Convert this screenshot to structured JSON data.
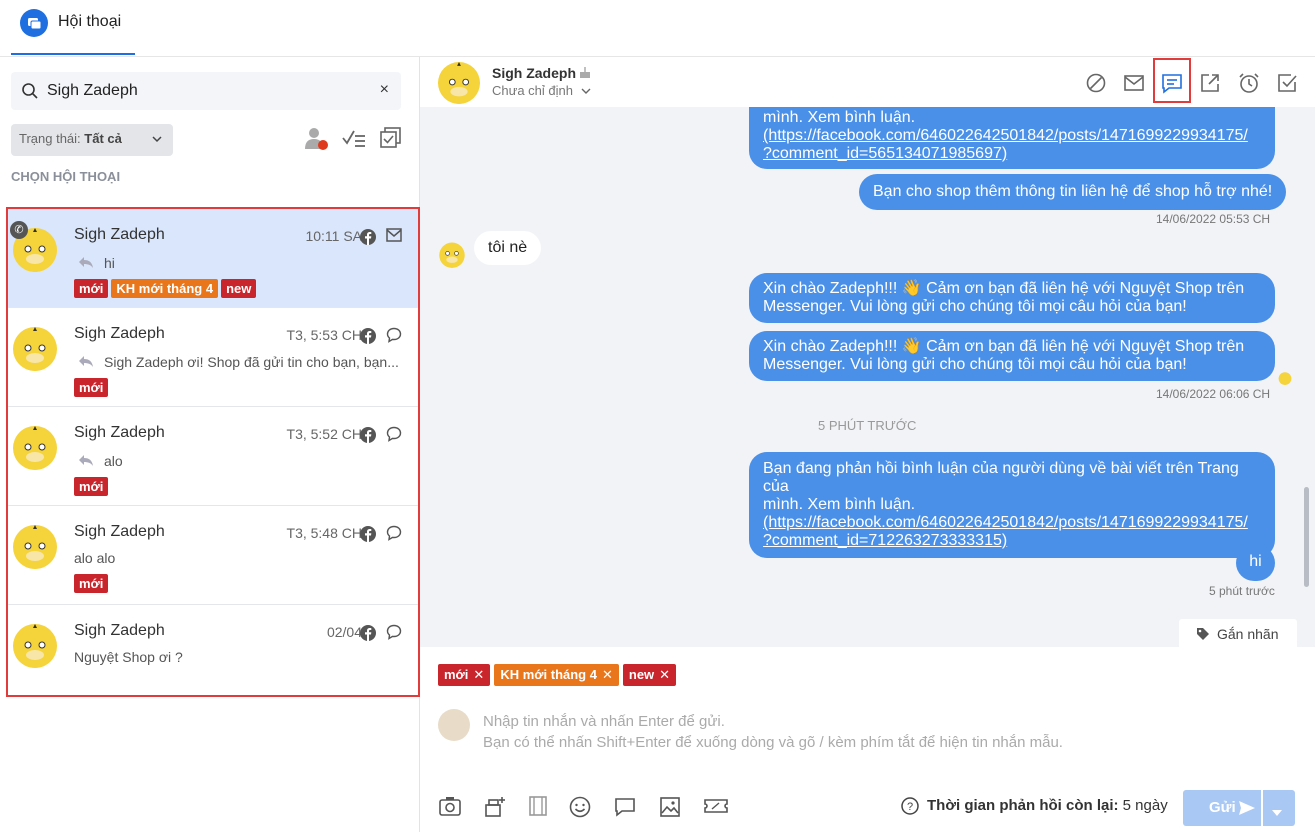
{
  "app": {
    "title": "Hội thoại"
  },
  "search": {
    "value": "Sigh Zadeph",
    "clear": "×"
  },
  "filter": {
    "status_label": "Trạng thái:",
    "status_value": "Tất cả"
  },
  "section_title": "CHỌN HỘI THOẠI",
  "conversations": [
    {
      "name": "Sigh Zadeph",
      "time": "10:11 SA",
      "last": "hi",
      "reply": true,
      "channel": "mail",
      "tags": [
        "mới",
        "KH mới tháng 4",
        "new"
      ]
    },
    {
      "name": "Sigh Zadeph",
      "time": "T3, 5:53 CH",
      "last": "Sigh Zadeph ơi! Shop đã gửi tin cho bạn, bạn...",
      "reply": true,
      "channel": "comment",
      "tags": [
        "mới"
      ]
    },
    {
      "name": "Sigh Zadeph",
      "time": "T3, 5:52 CH",
      "last": "alo",
      "reply": true,
      "channel": "comment",
      "tags": [
        "mới"
      ]
    },
    {
      "name": "Sigh Zadeph",
      "time": "T3, 5:48 CH",
      "last": "alo alo",
      "reply": false,
      "channel": "comment",
      "tags": [
        "mới"
      ]
    },
    {
      "name": "Sigh Zadeph",
      "time": "02/04",
      "last": "Nguyệt Shop ơi ?",
      "reply": false,
      "channel": "comment",
      "tags": []
    }
  ],
  "chat": {
    "name": "Sigh Zadeph",
    "assign": "Chưa chỉ định",
    "messages": {
      "m1_l1": "mình. Xem bình luận.",
      "m1_l2": "(https://facebook.com/646022642501842/posts/1471699229934175/",
      "m1_l3": "?comment_id=565134071985697)",
      "m2": "Bạn cho shop thêm thông tin liên hệ để shop hỗ trợ nhé!",
      "t1": "14/06/2022 05:53 CH",
      "in1": "tôi nè",
      "m3_l1": "Xin chào Zadeph!!! 👋 Cảm ơn bạn đã liên hệ với Nguyệt Shop trên",
      "m3_l2": "Messenger. Vui lòng gửi cho chúng tôi mọi câu hỏi của bạn!",
      "m4_l1": "Xin chào Zadeph!!! 👋 Cảm ơn bạn đã liên hệ với Nguyệt Shop trên",
      "m4_l2": "Messenger. Vui lòng gửi cho chúng tôi mọi câu hỏi của bạn!",
      "t2": "14/06/2022 06:06 CH",
      "divider": "5 PHÚT TRƯỚC",
      "m5_l1": "Bạn đang phản hồi bình luận của người dùng về bài viết trên Trang của",
      "m5_l2": "mình. Xem bình luận.",
      "m5_l3": "(https://facebook.com/646022642501842/posts/1471699229934175/",
      "m5_l4": "?comment_id=712263273333315)",
      "m6": "hi",
      "t3": "5 phút trước"
    },
    "label_button": "Gắn nhãn"
  },
  "composer": {
    "tags": [
      "mới",
      "KH mới tháng 4",
      "new"
    ],
    "placeholder": "Nhập tin nhắn và nhấn Enter để gửi.\nBạn có thể nhấn Shift+Enter để xuống dòng và gõ / kèm phím tắt để hiện tin nhắn mẫu.",
    "reply_time_label": "Thời gian phản hồi còn lại:",
    "reply_time_value": "5 ngày",
    "send": "Gửi"
  },
  "colors": {
    "primary": "#1f6fe0",
    "bubble": "#4a90e8",
    "tag_red": "#c8252c",
    "tag_orange": "#e9761a",
    "highlight": "#e23b3b",
    "active_row": "#d9e6fb"
  },
  "icons": [
    "chat-logo-icon",
    "search-icon",
    "close-icon",
    "chevron-down-icon",
    "user-status-icon",
    "checklist-icon",
    "select-all-icon",
    "facebook-icon",
    "mail-icon",
    "comment-icon",
    "reply-icon",
    "phone-icon",
    "block-icon",
    "message-icon",
    "external-link-icon",
    "alarm-icon",
    "check-square-icon",
    "tag-icon",
    "camera-icon",
    "product-icon",
    "video-icon",
    "emoji-icon",
    "speech-icon",
    "image-icon",
    "coupon-icon",
    "help-icon",
    "send-icon"
  ]
}
